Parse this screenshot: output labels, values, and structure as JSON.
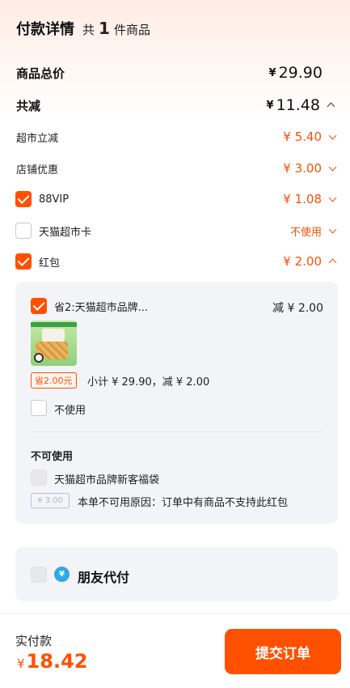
{
  "header": {
    "title": "付款详情",
    "count_prefix": "共",
    "count": "1",
    "count_suffix": "件商品"
  },
  "summary": {
    "total_label": "商品总价",
    "total_value": "29.90",
    "discount_label": "共减",
    "discount_value": "11.48",
    "currency": "¥"
  },
  "discounts": [
    {
      "label": "超市立减",
      "value": "¥ 5.40"
    },
    {
      "label": "店铺优惠",
      "value": "¥ 3.00"
    },
    {
      "label": "88VIP",
      "value": "¥ 1.08",
      "checked": true
    },
    {
      "label": "天猫超市卡",
      "value": "不使用",
      "checked": false
    },
    {
      "label": "红包",
      "value": "¥ 2.00",
      "checked": true
    }
  ],
  "redpacket_panel": {
    "selected_name": "省2:天猫超市品牌...",
    "selected_reduce": "减 ¥ 2.00",
    "save_tag": "省2.00元",
    "subtotal_text": "小计 ¥ 29.90，减 ¥ 2.00",
    "not_use_label": "不使用",
    "unavailable_title": "不可使用",
    "unavailable_name": "天猫超市品牌新客福袋",
    "unavailable_tag": "¥ 3.00",
    "unavailable_reason": "本单不可用原因：订单中有商品不支持此红包"
  },
  "friend_pay": {
    "label": "朋友代付",
    "icon": "yen-hand-icon"
  },
  "footer": {
    "pay_label": "实付款",
    "pay_currency": "¥",
    "pay_amount": "18.42",
    "submit_label": "提交订单"
  },
  "colors": {
    "accent": "#ff5000",
    "panel_bg": "#f3f4f8",
    "header_gradient": "#fdece3"
  }
}
